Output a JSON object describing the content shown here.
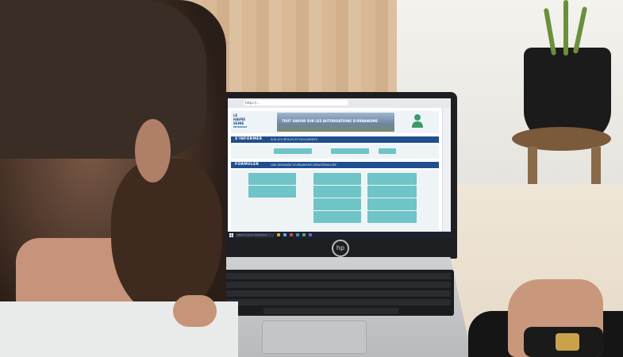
{
  "scene": {
    "description_colors": {
      "accent": "#1f4f8f",
      "tile": "#6ec4c7",
      "background": "#d8e8ee"
    },
    "laptop_brand_logo": "hp"
  },
  "browser": {
    "url_text": "https://...",
    "tab_title": ""
  },
  "website": {
    "logo": {
      "line1": "LE",
      "line2": "HAVRE",
      "line3": "SEINE",
      "line4": "MÉTROPOLE"
    },
    "banner_text": "TOUT SAVOIR SUR LES AUTORISATIONS D'URBANISME",
    "user_label": "",
    "section1": {
      "title": "S'INFORMER",
      "subtitle": "SUR LES RÈGLES ET DOCUMENTS",
      "buttons": [
        "",
        "",
        ""
      ]
    },
    "section2": {
      "title": "FORMULER",
      "subtitle": "UNE DEMANDE D'URBANISME DÉMATÉRIALISÉE",
      "tiles": [
        "",
        "",
        "",
        "",
        "",
        "",
        "",
        "",
        "",
        ""
      ]
    }
  },
  "taskbar": {
    "search_placeholder": "Taper ici pour rechercher",
    "clock": ""
  }
}
